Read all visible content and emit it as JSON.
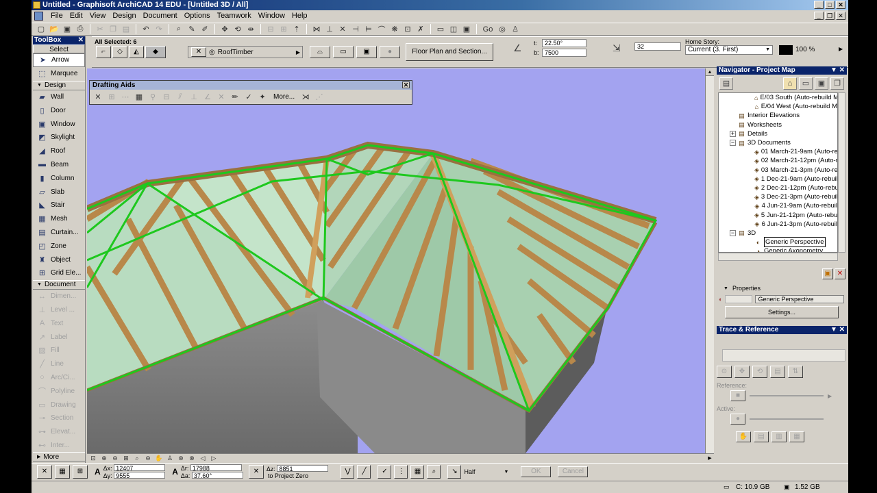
{
  "window": {
    "title": "Untitled - Graphisoft ArchiCAD 14 EDU - [Untitled 3D / All]"
  },
  "menu": [
    "File",
    "Edit",
    "View",
    "Design",
    "Document",
    "Options",
    "Teamwork",
    "Window",
    "Help"
  ],
  "go_label": "Go",
  "infobox": {
    "selection": "All Selected: 6",
    "roof_type": "RoofTimber",
    "floorplan_button": "Floor Plan and Section...",
    "angle": "22.50°",
    "b_value": "7500",
    "t_label": "t:",
    "b_label": "b:",
    "thickness": "32",
    "home_story_label": "Home Story:",
    "home_story_value": "Current (3. First)",
    "pen_percent": "100 %"
  },
  "toolbox": {
    "title": "ToolBox",
    "select_label": "Select",
    "select_items": [
      {
        "label": "Arrow",
        "icon": "arrow-icon",
        "glyph": "➤"
      },
      {
        "label": "Marquee",
        "icon": "marquee-icon",
        "glyph": "⬚"
      }
    ],
    "design_label": "Design",
    "design_items": [
      {
        "label": "Wall",
        "icon": "wall-icon",
        "glyph": "▰"
      },
      {
        "label": "Door",
        "icon": "door-icon",
        "glyph": "▯"
      },
      {
        "label": "Window",
        "icon": "window-icon",
        "glyph": "▣"
      },
      {
        "label": "Skylight",
        "icon": "skylight-icon",
        "glyph": "◩"
      },
      {
        "label": "Roof",
        "icon": "roof-icon",
        "glyph": "◢"
      },
      {
        "label": "Beam",
        "icon": "beam-icon",
        "glyph": "▬"
      },
      {
        "label": "Column",
        "icon": "column-icon",
        "glyph": "▮"
      },
      {
        "label": "Slab",
        "icon": "slab-icon",
        "glyph": "▱"
      },
      {
        "label": "Stair",
        "icon": "stair-icon",
        "glyph": "◣"
      },
      {
        "label": "Mesh",
        "icon": "mesh-icon",
        "glyph": "▦"
      },
      {
        "label": "Curtain...",
        "icon": "curtain-wall-icon",
        "glyph": "▤"
      },
      {
        "label": "Zone",
        "icon": "zone-icon",
        "glyph": "◰"
      },
      {
        "label": "Object",
        "icon": "object-icon",
        "glyph": "♜"
      },
      {
        "label": "Grid Ele...",
        "icon": "grid-element-icon",
        "glyph": "⊞"
      }
    ],
    "document_label": "Document",
    "document_items": [
      {
        "label": "Dimen...",
        "icon": "dimension-icon",
        "glyph": "↔"
      },
      {
        "label": "Level ...",
        "icon": "level-icon",
        "glyph": "⊥"
      },
      {
        "label": "Text",
        "icon": "text-icon",
        "glyph": "A"
      },
      {
        "label": "Label",
        "icon": "label-icon",
        "glyph": "↗"
      },
      {
        "label": "Fill",
        "icon": "fill-icon",
        "glyph": "▨"
      },
      {
        "label": "Line",
        "icon": "line-icon",
        "glyph": "╱"
      },
      {
        "label": "Arc/Ci...",
        "icon": "arc-icon",
        "glyph": "○"
      },
      {
        "label": "Polyline",
        "icon": "polyline-icon",
        "glyph": "⌒"
      },
      {
        "label": "Drawing",
        "icon": "drawing-icon",
        "glyph": "▭"
      },
      {
        "label": "Section",
        "icon": "section-icon",
        "glyph": "⊸"
      },
      {
        "label": "Elevat...",
        "icon": "elevation-icon",
        "glyph": "⊶"
      },
      {
        "label": "Inter...",
        "icon": "interior-elevation-icon",
        "glyph": "⊷"
      }
    ],
    "more_label": "More"
  },
  "drafting_aids": {
    "title": "Drafting Aids",
    "more_label": "More..."
  },
  "navigator": {
    "title": "Navigator - Project Map",
    "tree": [
      {
        "label": "E/03 South (Auto-rebuild M",
        "indent": 4,
        "icon": "elevation-house-icon",
        "glyph": "⌂",
        "sel": false
      },
      {
        "label": "E/04 West (Auto-rebuild M",
        "indent": 4,
        "icon": "elevation-house-icon",
        "glyph": "⌂",
        "sel": false
      },
      {
        "label": "Interior Elevations",
        "indent": 2,
        "icon": "folder-icon",
        "glyph": "▤",
        "sel": false
      },
      {
        "label": "Worksheets",
        "indent": 2,
        "icon": "folder-icon",
        "glyph": "▤",
        "sel": false
      },
      {
        "label": "Details",
        "indent": 2,
        "icon": "folder-icon",
        "glyph": "▤",
        "sel": false
      },
      {
        "label": "3D Documents",
        "indent": 2,
        "icon": "folder-icon",
        "glyph": "▤",
        "sel": false
      },
      {
        "label": "01 March-21-9am (Auto-re",
        "indent": 4,
        "icon": "3d-document-icon",
        "glyph": "◈",
        "sel": false
      },
      {
        "label": "02 March-21-12pm (Auto-re",
        "indent": 4,
        "icon": "3d-document-icon",
        "glyph": "◈",
        "sel": false
      },
      {
        "label": "03 March-21-3pm (Auto-re",
        "indent": 4,
        "icon": "3d-document-icon",
        "glyph": "◈",
        "sel": false
      },
      {
        "label": "1 Dec-21-9am (Auto-rebuil",
        "indent": 4,
        "icon": "3d-document-icon",
        "glyph": "◈",
        "sel": false
      },
      {
        "label": "2 Dec-21-12pm (Auto-rebuil",
        "indent": 4,
        "icon": "3d-document-icon",
        "glyph": "◈",
        "sel": false
      },
      {
        "label": "3 Dec-21-3pm (Auto-rebuil",
        "indent": 4,
        "icon": "3d-document-icon",
        "glyph": "◈",
        "sel": false
      },
      {
        "label": "4 Jun-21-9am (Auto-rebuil",
        "indent": 4,
        "icon": "3d-document-icon",
        "glyph": "◈",
        "sel": false
      },
      {
        "label": "5 Jun-21-12pm (Auto-rebuil",
        "indent": 4,
        "icon": "3d-document-icon",
        "glyph": "◈",
        "sel": false
      },
      {
        "label": "6 Jun-21-3pm (Auto-rebuil",
        "indent": 4,
        "icon": "3d-document-icon",
        "glyph": "◈",
        "sel": false
      },
      {
        "label": "3D",
        "indent": 2,
        "icon": "3d-folder-icon",
        "glyph": "▤",
        "sel": false
      },
      {
        "label": "Generic Perspective",
        "indent": 4,
        "icon": "perspective-camera-icon",
        "glyph": "◐",
        "sel": true
      },
      {
        "label": "Generic Axonometry",
        "indent": 4,
        "icon": "axonometry-icon",
        "glyph": "◑",
        "sel": false
      }
    ]
  },
  "properties": {
    "title": "Properties",
    "view_name": "Generic Perspective",
    "settings_label": "Settings..."
  },
  "trace": {
    "title": "Trace & Reference",
    "reference_label": "Reference:",
    "active_label": "Active:"
  },
  "coords": {
    "dx": "12407",
    "dy": "9555",
    "dx_label": "Δx:",
    "dy_label": "Δy:",
    "dr": "17988",
    "da": "37.60°",
    "dr_label": "Δr:",
    "da_label": "Δa:",
    "dz": "8851",
    "dz_label": "Δz:",
    "dz_ref": "to Project Zero",
    "snap": "Half",
    "ok_label": "OK",
    "cancel_label": "Cancel"
  },
  "status": {
    "disk_c": "C: 10.9 GB",
    "memory": "1.52 GB"
  },
  "colors": {
    "viewport_bg": "#a3a3f0",
    "timber": "#c8a060",
    "selection_green": "#20c020",
    "roof_glass": "#c8e8c8"
  }
}
